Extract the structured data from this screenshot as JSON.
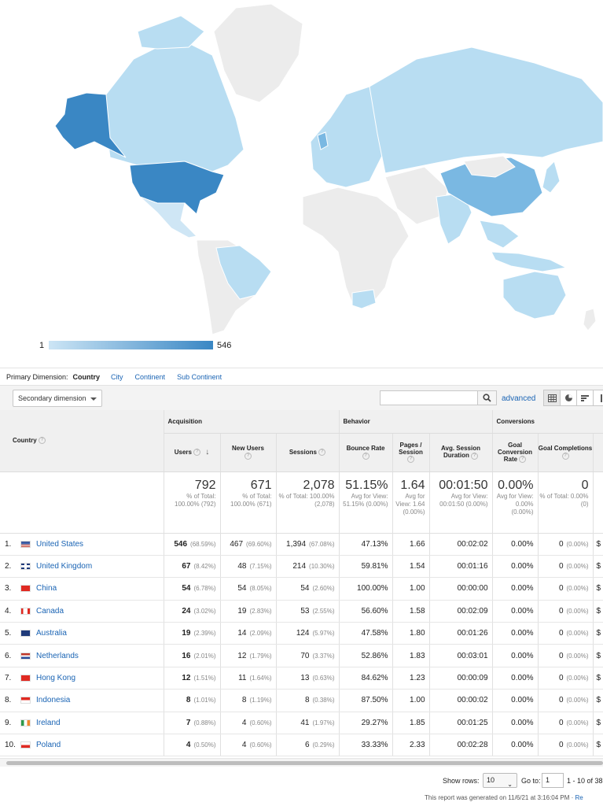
{
  "map": {
    "legend_min": "1",
    "legend_max": "546",
    "colors": {
      "low": "#b8ddf2",
      "mid": "#7ab8e2",
      "high": "#3a87c4",
      "none": "#ececec"
    }
  },
  "dimension": {
    "label": "Primary Dimension:",
    "current": "Country",
    "options": [
      "City",
      "Continent",
      "Sub Continent"
    ]
  },
  "toolbar": {
    "secondary_dimension": "Secondary dimension",
    "search_placeholder": "",
    "advanced": "advanced"
  },
  "table": {
    "groups": {
      "acquisition": "Acquisition",
      "behavior": "Behavior",
      "conversions": "Conversions"
    },
    "headers": {
      "country": "Country",
      "users": "Users",
      "new_users": "New Users",
      "sessions": "Sessions",
      "bounce_rate": "Bounce Rate",
      "pages_session": "Pages / Session",
      "avg_session": "Avg. Session Duration",
      "goal_conv": "Goal Conversion Rate",
      "goal_comp": "Goal Completions",
      "goal_value": "G"
    },
    "totals": {
      "users": "792",
      "users_sub": "% of Total: 100.00% (792)",
      "new_users": "671",
      "new_users_sub": "% of Total: 100.00% (671)",
      "sessions": "2,078",
      "sessions_sub": "% of Total: 100.00% (2,078)",
      "bounce": "51.15%",
      "bounce_sub": "Avg for View: 51.15% (0.00%)",
      "pages": "1.64",
      "pages_sub": "Avg for View: 1.64 (0.00%)",
      "duration": "00:01:50",
      "duration_sub": "Avg for View: 00:01:50 (0.00%)",
      "conv": "0.00%",
      "conv_sub": "Avg for View: 0.00% (0.00%)",
      "comp": "0",
      "comp_sub": "% of Total: 0.00% (0)"
    },
    "rows": [
      {
        "i": "1.",
        "flag": "us",
        "country": "United States",
        "users": "546",
        "users_pct": "(68.59%)",
        "new": "467",
        "new_pct": "(69.60%)",
        "sess": "1,394",
        "sess_pct": "(67.08%)",
        "bounce": "47.13%",
        "pages": "1.66",
        "dur": "00:02:02",
        "conv": "0.00%",
        "comp": "0",
        "comp_pct": "(0.00%)",
        "val": "$"
      },
      {
        "i": "2.",
        "flag": "gb",
        "country": "United Kingdom",
        "users": "67",
        "users_pct": "(8.42%)",
        "new": "48",
        "new_pct": "(7.15%)",
        "sess": "214",
        "sess_pct": "(10.30%)",
        "bounce": "59.81%",
        "pages": "1.54",
        "dur": "00:01:16",
        "conv": "0.00%",
        "comp": "0",
        "comp_pct": "(0.00%)",
        "val": "$"
      },
      {
        "i": "3.",
        "flag": "cn",
        "country": "China",
        "users": "54",
        "users_pct": "(6.78%)",
        "new": "54",
        "new_pct": "(8.05%)",
        "sess": "54",
        "sess_pct": "(2.60%)",
        "bounce": "100.00%",
        "pages": "1.00",
        "dur": "00:00:00",
        "conv": "0.00%",
        "comp": "0",
        "comp_pct": "(0.00%)",
        "val": "$"
      },
      {
        "i": "4.",
        "flag": "ca",
        "country": "Canada",
        "users": "24",
        "users_pct": "(3.02%)",
        "new": "19",
        "new_pct": "(2.83%)",
        "sess": "53",
        "sess_pct": "(2.55%)",
        "bounce": "56.60%",
        "pages": "1.58",
        "dur": "00:02:09",
        "conv": "0.00%",
        "comp": "0",
        "comp_pct": "(0.00%)",
        "val": "$"
      },
      {
        "i": "5.",
        "flag": "au",
        "country": "Australia",
        "users": "19",
        "users_pct": "(2.39%)",
        "new": "14",
        "new_pct": "(2.09%)",
        "sess": "124",
        "sess_pct": "(5.97%)",
        "bounce": "47.58%",
        "pages": "1.80",
        "dur": "00:01:26",
        "conv": "0.00%",
        "comp": "0",
        "comp_pct": "(0.00%)",
        "val": "$"
      },
      {
        "i": "6.",
        "flag": "nl",
        "country": "Netherlands",
        "users": "16",
        "users_pct": "(2.01%)",
        "new": "12",
        "new_pct": "(1.79%)",
        "sess": "70",
        "sess_pct": "(3.37%)",
        "bounce": "52.86%",
        "pages": "1.83",
        "dur": "00:03:01",
        "conv": "0.00%",
        "comp": "0",
        "comp_pct": "(0.00%)",
        "val": "$"
      },
      {
        "i": "7.",
        "flag": "hk",
        "country": "Hong Kong",
        "users": "12",
        "users_pct": "(1.51%)",
        "new": "11",
        "new_pct": "(1.64%)",
        "sess": "13",
        "sess_pct": "(0.63%)",
        "bounce": "84.62%",
        "pages": "1.23",
        "dur": "00:00:09",
        "conv": "0.00%",
        "comp": "0",
        "comp_pct": "(0.00%)",
        "val": "$"
      },
      {
        "i": "8.",
        "flag": "id",
        "country": "Indonesia",
        "users": "8",
        "users_pct": "(1.01%)",
        "new": "8",
        "new_pct": "(1.19%)",
        "sess": "8",
        "sess_pct": "(0.38%)",
        "bounce": "87.50%",
        "pages": "1.00",
        "dur": "00:00:02",
        "conv": "0.00%",
        "comp": "0",
        "comp_pct": "(0.00%)",
        "val": "$"
      },
      {
        "i": "9.",
        "flag": "ie",
        "country": "Ireland",
        "users": "7",
        "users_pct": "(0.88%)",
        "new": "4",
        "new_pct": "(0.60%)",
        "sess": "41",
        "sess_pct": "(1.97%)",
        "bounce": "29.27%",
        "pages": "1.85",
        "dur": "00:01:25",
        "conv": "0.00%",
        "comp": "0",
        "comp_pct": "(0.00%)",
        "val": "$"
      },
      {
        "i": "10.",
        "flag": "pl",
        "country": "Poland",
        "users": "4",
        "users_pct": "(0.50%)",
        "new": "4",
        "new_pct": "(0.60%)",
        "sess": "6",
        "sess_pct": "(0.29%)",
        "bounce": "33.33%",
        "pages": "2.33",
        "dur": "00:02:28",
        "conv": "0.00%",
        "comp": "0",
        "comp_pct": "(0.00%)",
        "val": "$"
      }
    ]
  },
  "pager": {
    "show_rows_label": "Show rows:",
    "show_rows_value": "10",
    "goto_label": "Go to:",
    "goto_value": "1",
    "range": "1 - 10 of 38"
  },
  "footer": {
    "text": "This report was generated on 11/6/21 at 3:16:04 PM · ",
    "link": "Re"
  }
}
